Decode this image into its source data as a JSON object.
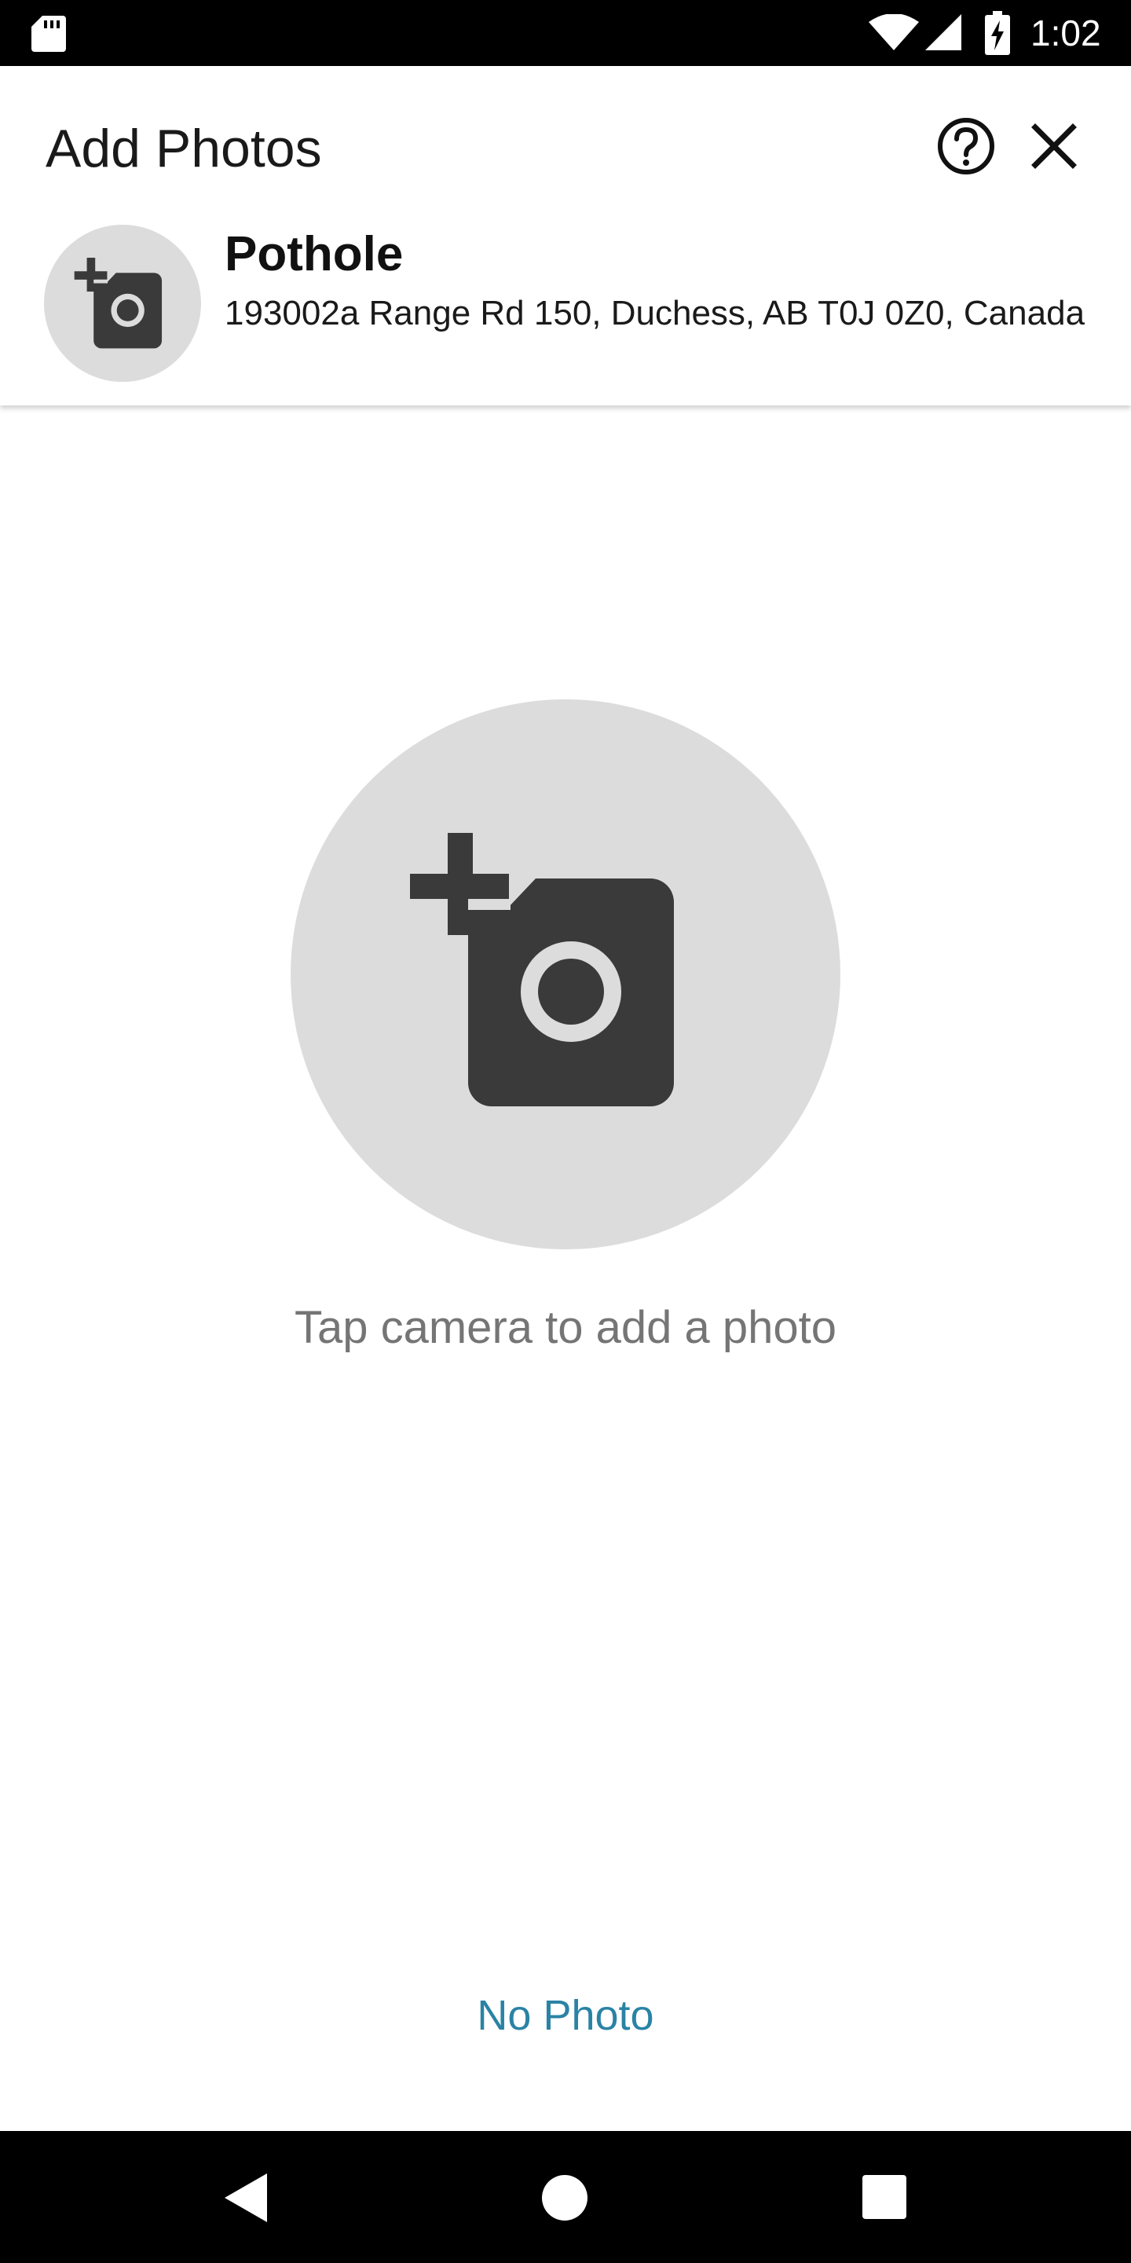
{
  "status_bar": {
    "time": "1:02",
    "icons": [
      "sd-card-icon",
      "wifi-icon",
      "cell-signal-icon",
      "battery-charging-icon"
    ]
  },
  "header": {
    "title": "Add Photos",
    "icons": {
      "help": "help-circle-icon",
      "close": "close-icon"
    }
  },
  "report": {
    "title": "Pothole",
    "address": "193002a Range Rd 150, Duchess, AB T0J 0Z0, Canada",
    "icon": "add-camera-icon"
  },
  "main": {
    "camera_icon": "add-camera-icon",
    "hint": "Tap camera to add a photo"
  },
  "footer": {
    "no_photo_label": "No Photo"
  },
  "nav": {
    "icons": [
      "back-icon",
      "home-icon",
      "recents-icon"
    ]
  },
  "colors": {
    "accent": "#2a83a5",
    "circle_bg": "#dcdcdc",
    "icon_dark": "#3a3a3a",
    "hint_text": "#757575"
  }
}
